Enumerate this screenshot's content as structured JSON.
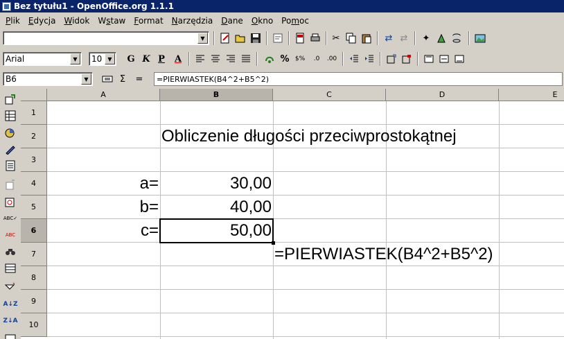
{
  "window": {
    "title": "Bez tytułu1 - OpenOffice.org 1.1.1"
  },
  "menu": [
    {
      "pre": "",
      "ul": "P",
      "post": "lik"
    },
    {
      "pre": "",
      "ul": "E",
      "post": "dycja"
    },
    {
      "pre": "",
      "ul": "W",
      "post": "idok"
    },
    {
      "pre": "W",
      "ul": "s",
      "post": "taw"
    },
    {
      "pre": "",
      "ul": "F",
      "post": "ormat"
    },
    {
      "pre": "",
      "ul": "N",
      "post": "arzędzia"
    },
    {
      "pre": "",
      "ul": "D",
      "post": "ane"
    },
    {
      "pre": "",
      "ul": "O",
      "post": "kno"
    },
    {
      "pre": "Po",
      "ul": "m",
      "post": "oc"
    }
  ],
  "toolbar": {
    "url_value": ""
  },
  "format": {
    "font_name": "Arial",
    "font_size": "10",
    "bold": "G",
    "italic": "K",
    "underline": "P",
    "font_color": "A"
  },
  "formula_bar": {
    "name_box": "B6",
    "sum_symbol": "Σ",
    "equals_symbol": "=",
    "formula": "=PIERWIASTEK(B4^2+B5^2)"
  },
  "columns": [
    "A",
    "B",
    "C",
    "D",
    "E"
  ],
  "rows": [
    "1",
    "2",
    "3",
    "4",
    "5",
    "6",
    "7",
    "8",
    "9",
    "10"
  ],
  "cells": {
    "b2": "Obliczenie długości przeciwprostokątnej",
    "a4": "a=",
    "b4": "30,00",
    "a5": "b=",
    "b5": "40,00",
    "a6": "c=",
    "b6": "50,00",
    "c7": "=PIERWIASTEK(B4^2+B5^2)"
  },
  "selection": {
    "active_column": "B",
    "active_row": "6"
  }
}
